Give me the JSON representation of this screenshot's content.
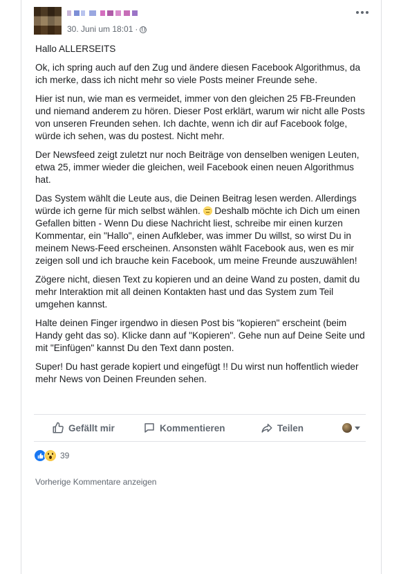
{
  "post": {
    "author_name": "",
    "timestamp": "30. Juni um 18:01",
    "separator": "·",
    "privacy_icon": "globe-icon",
    "paragraphs": [
      "Hallo ALLERSEITS",
      "Ok, ich spring auch auf den Zug und ändere diesen Facebook Algorithmus, da ich merke, dass ich nicht mehr so viele Posts meiner Freunde sehe.",
      "Hier ist nun, wie man es vermeidet, immer von den gleichen 25 FB-Freunden und niemand anderem zu hören. Dieser Post erklärt, warum wir nicht alle Posts von unseren Freunden sehen. Ich dachte, wenn ich dir auf Facebook folge, würde ich sehen, was du postest. Nicht mehr.",
      "Der Newsfeed zeigt zuletzt nur noch Beiträge von denselben wenigen Leuten, etwa 25, immer wieder die gleichen, weil Facebook einen neuen Algorithmus hat."
    ],
    "paragraph5_part1": "Das System wählt die Leute aus, die Deinen Beitrag lesen werden. Allerdings würde ich gerne für mich selbst wählen. ",
    "paragraph5_part2": " Deshalb möchte ich Dich um einen Gefallen bitten - Wenn Du diese Nachricht liest, schreibe mir einen kurzen Kommentar, ein \"Hallo\", einen Aufkleber, was immer Du willst, so wirst Du in meinem News-Feed erscheinen. Ansonsten wählt Facebook aus, wen es mir zeigen soll und ich brauche kein Facebook, um meine Freunde auszuwählen!",
    "paragraphs_after": [
      "Zögere nicht, diesen Text zu kopieren und an deine Wand zu posten, damit du mehr Interaktion mit all deinen Kontakten hast und das System zum Teil umgehen kannst.",
      "Halte deinen Finger irgendwo in diesen Post bis \"kopieren\" erscheint (beim Handy geht das so). Klicke dann auf \"Kopieren\". Gehe nun auf Deine Seite und mit \"Einfügen\" kannst Du den Text dann posten.",
      "Super! Du hast gerade kopiert und eingefügt !! Du wirst nun hoffentlich wieder mehr News von Deinen Freunden sehen."
    ]
  },
  "actions": {
    "like_label": "Gefällt mir",
    "comment_label": "Kommentieren",
    "share_label": "Teilen"
  },
  "reactions": {
    "count": "39",
    "types": [
      "like",
      "wow"
    ]
  },
  "comments": {
    "previous_label": "Vorherige Kommentare anzeigen"
  },
  "colors": {
    "facebook_blue": "#1877f2",
    "secondary_text": "#606770",
    "primary_text": "#1c1e21"
  }
}
